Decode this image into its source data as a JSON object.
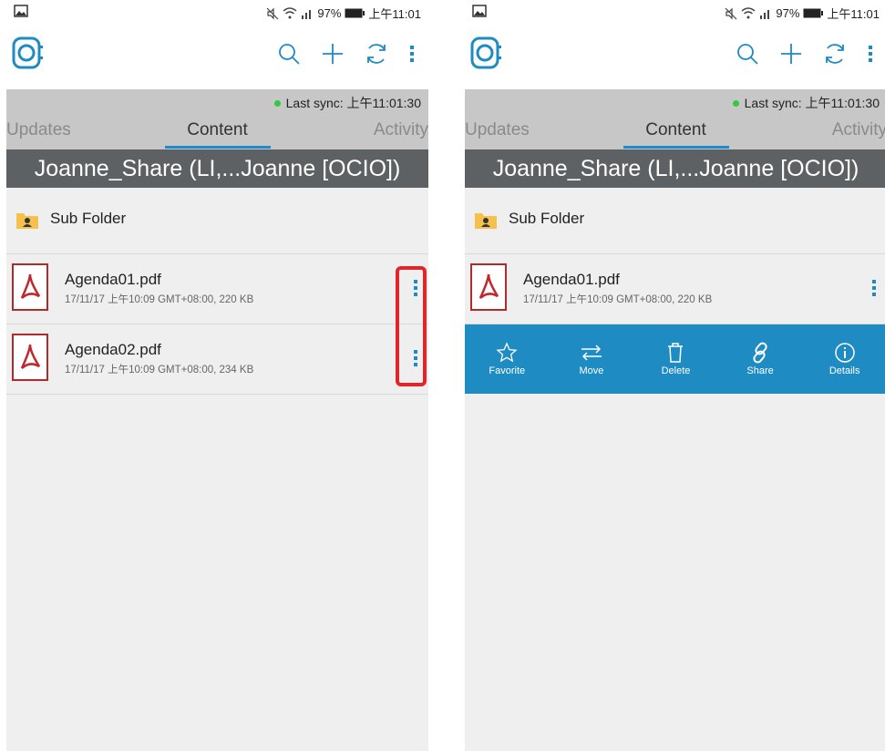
{
  "status_bar": {
    "signal_text": "97%",
    "time": "上午11:01"
  },
  "sync": {
    "label": "Last sync: 上午11:01:30"
  },
  "tabs": [
    {
      "label": "Updates"
    },
    {
      "label": "Content"
    },
    {
      "label": "Activity"
    }
  ],
  "folder_path": "Joanne_Share (LI,...Joanne [OCIO])",
  "items": {
    "sub_folder": "Sub Folder",
    "files": [
      {
        "name": "Agenda01.pdf",
        "meta": "17/11/17 上午10:09 GMT+08:00, 220 KB"
      },
      {
        "name": "Agenda02.pdf",
        "meta": "17/11/17 上午10:09 GMT+08:00, 234 KB"
      }
    ]
  },
  "actions": [
    {
      "label": "Favorite",
      "icon": "star-icon"
    },
    {
      "label": "Move",
      "icon": "move-arrows-icon"
    },
    {
      "label": "Delete",
      "icon": "trash-icon"
    },
    {
      "label": "Share",
      "icon": "link-icon"
    },
    {
      "label": "Details",
      "icon": "info-icon"
    }
  ],
  "colors": {
    "accent": "#1e8bc3",
    "path_bar": "#5d6163",
    "highlight": "#e0262b"
  }
}
